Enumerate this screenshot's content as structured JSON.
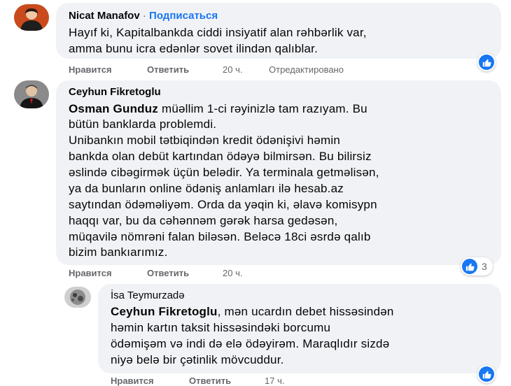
{
  "colors": {
    "accent": "#1877f2",
    "bubble": "#f0f2f5",
    "meta": "#65676b"
  },
  "comments": [
    {
      "author": "Nicat Manafov",
      "separator": "·",
      "subscribe": "Подписаться",
      "lines": [
        "Hayıf ki, Kapitalbankda ciddi insiyatif alan rəhbərlik var,",
        "amma bunu icra edənlər sovet ilindən qalıblar."
      ],
      "actions": {
        "like": "Нравится",
        "reply": "Ответить",
        "time": "20 ч.",
        "edited": "Отредактировано"
      },
      "reaction_icon": "thumbs-up-icon"
    },
    {
      "author": "Ceyhun Fikretoglu",
      "mention": "Osman Gunduz",
      "lines": [
        " müəllim 1-ci rəyinizlə tam razıyam. Bu",
        "bütün banklarda problemdi.",
        "Unibankın mobil tətbiqindən kredit ödənişivi həmin",
        "bankda olan debüt kartından ödəyə bilmirsən. Bu bilirsiz",
        "əslində cibəgirmək üçün belədir. Ya terminala getməlisən,",
        "ya da bunların online ödəniş anlamları ilə hesab.az",
        "saytından ödəməliyəm. Orda da yəqin ki, əlavə komisypn",
        "haqqı var, bu da cəhənnəm gərək harsa gedəsən,",
        "müqavilə nömrəni falan biləsən. Beləcə 18ci əsrdə qalıb",
        "bizim bankıarımız."
      ],
      "actions": {
        "like": "Нравится",
        "reply": "Ответить",
        "time": "20 ч."
      },
      "reaction_count": "3",
      "reaction_icon": "thumbs-up-icon"
    },
    {
      "author": "İsa Teymurzadə",
      "mention": "Ceyhun Fikretoglu",
      "lines": [
        ", mən ucardın debet hissəsindən",
        "həmin kartın taksit hissəsindəki borcumu",
        "ödəmişəm və indi də elə ödəyirəm. Maraqlıdır sizdə",
        "niyə belə bir çətinlik mövcuddur."
      ],
      "actions": {
        "like": "Нравится",
        "reply": "Ответить",
        "time": "17 ч."
      },
      "reaction_icon": "thumbs-up-icon"
    }
  ]
}
